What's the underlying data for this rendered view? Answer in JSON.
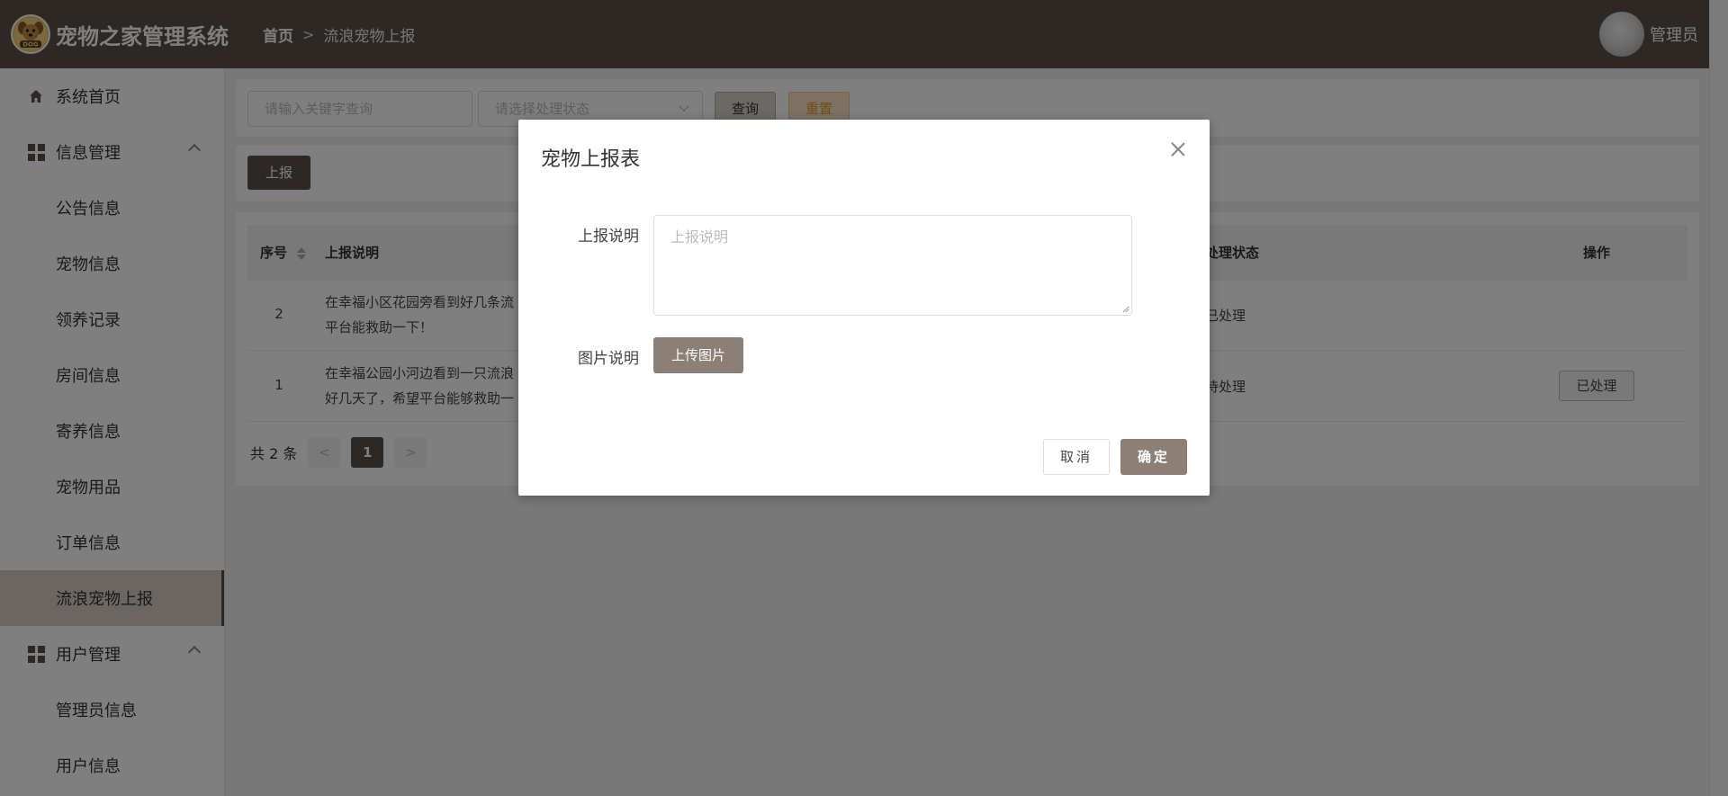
{
  "header": {
    "app_title": "宠物之家管理系统",
    "logo_text": "DOG",
    "breadcrumb": {
      "home": "首页",
      "separator": ">",
      "current": "流浪宠物上报"
    },
    "user_name": "管理员"
  },
  "sidebar": {
    "items": [
      {
        "label": "系统首页",
        "level": "top",
        "icon": "home-icon"
      },
      {
        "label": "信息管理",
        "level": "group",
        "icon": "grid-icon",
        "expanded": true
      },
      {
        "label": "公告信息",
        "level": "sub"
      },
      {
        "label": "宠物信息",
        "level": "sub"
      },
      {
        "label": "领养记录",
        "level": "sub"
      },
      {
        "label": "房间信息",
        "level": "sub"
      },
      {
        "label": "寄养信息",
        "level": "sub"
      },
      {
        "label": "宠物用品",
        "level": "sub"
      },
      {
        "label": "订单信息",
        "level": "sub"
      },
      {
        "label": "流浪宠物上报",
        "level": "sub",
        "active": true
      },
      {
        "label": "用户管理",
        "level": "group",
        "icon": "grid-icon",
        "expanded": true
      },
      {
        "label": "管理员信息",
        "level": "sub"
      },
      {
        "label": "用户信息",
        "level": "sub"
      }
    ]
  },
  "search": {
    "keyword_placeholder": "请输入关键字查询",
    "status_placeholder": "请选择处理状态",
    "query_label": "查询",
    "reset_label": "重置"
  },
  "actions": {
    "report_label": "上报"
  },
  "table": {
    "columns": {
      "index": "序号",
      "description": "上报说明",
      "status": "处理状态",
      "operation": "操作"
    },
    "rows": [
      {
        "index": "2",
        "desc_line1": "在幸福小区花园旁看到好几条流",
        "desc_line2": "平台能救助一下！",
        "status": "已处理",
        "action": ""
      },
      {
        "index": "1",
        "desc_line1": "在幸福公园小河边看到一只流浪",
        "desc_line2": "好几天了，希望平台能够救助一",
        "status": "待处理",
        "action": "已处理"
      }
    ]
  },
  "pagination": {
    "total_text": "共 2 条",
    "prev": "<",
    "current": "1",
    "next": ">"
  },
  "dialog": {
    "title": "宠物上报表",
    "desc_label": "上报说明",
    "desc_placeholder": "上报说明",
    "image_label": "图片说明",
    "upload_label": "上传图片",
    "cancel_label": "取消",
    "confirm_label": "确定"
  },
  "colors": {
    "header_bg": "#5b5048",
    "primary_button": "#8c8076",
    "active_menu_bg": "#d6cdc5",
    "reset_button_bg": "#fbe3c2"
  }
}
